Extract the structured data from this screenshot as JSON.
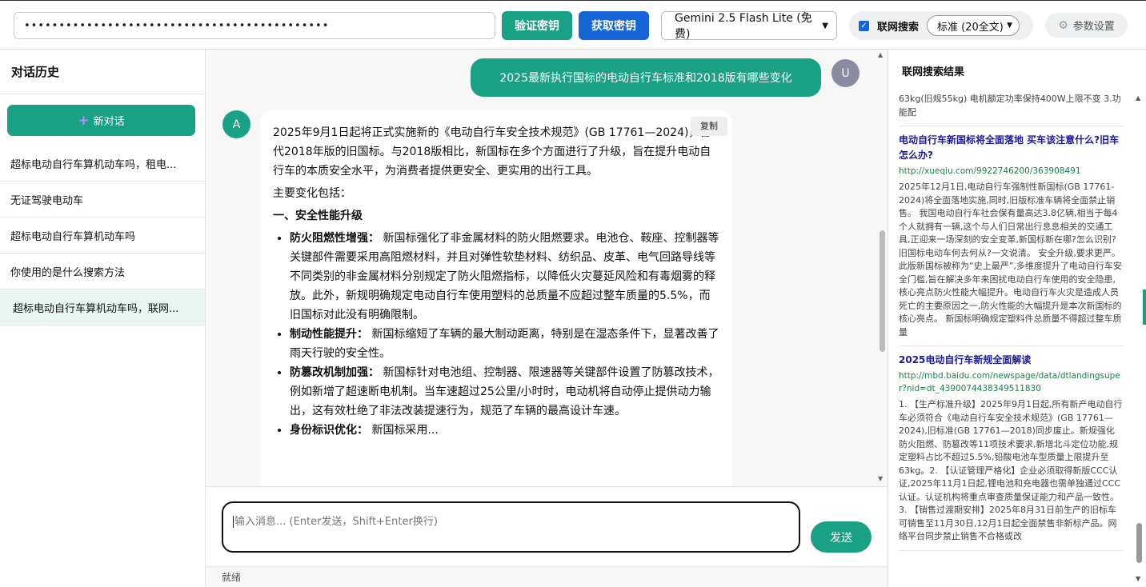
{
  "topbar": {
    "api_key_value": "••••••••••••••••••••••••••••••••••••••••••••",
    "verify_key_label": "验证密钥",
    "get_key_label": "获取密钥",
    "model_selected": "Gemini 2.5 Flash Lite (免费)",
    "web_search_label": "联网搜索",
    "web_search_checked": true,
    "search_mode_selected": "标准 (20全文)",
    "settings_label": "参数设置"
  },
  "sidebar": {
    "title": "对话历史",
    "new_chat_label": "新对话",
    "items": [
      {
        "label": "超标电动自行车算机动车吗，租电..."
      },
      {
        "label": "无证驾驶电动车"
      },
      {
        "label": "超标电动自行车算机动车吗"
      },
      {
        "label": "你使用的是什么搜索方法"
      },
      {
        "label": "超标电动自行车算机动车吗，联网..."
      }
    ],
    "active_index": 4
  },
  "chat": {
    "user_avatar": "U",
    "user_message": "2025最新执行国标的电动自行车标准和2018版有哪些变化",
    "ai_avatar": "A",
    "copy_label": "复制",
    "ai_intro": "2025年9月1日起将正式实施新的《电动自行车安全技术规范》(GB 17761—2024)，替代2018年版的旧国标。与2018版相比，新国标在多个方面进行了升级，旨在提升电动自行车的本质安全水平，为消费者提供更安全、更实用的出行工具。",
    "ai_changes_intro": "主要变化包括：",
    "section1_title": "一、安全性能升级",
    "bullets": [
      {
        "bold": "防火阻燃性增强：",
        "text": " 新国标强化了非金属材料的防火阻燃要求。电池仓、鞍座、控制器等关键部件需要采用高阻燃材料，并且对弹性软垫材料、纺织品、皮革、电气回路导线等不同类别的非金属材料分别规定了防火阻燃指标，以降低火灾蔓延风险和有毒烟雾的释放。此外，新规明确规定电动自行车使用塑料的总质量不应超过整车质量的5.5%，而旧国标对此没有明确限制。"
      },
      {
        "bold": "制动性能提升：",
        "text": " 新国标缩短了车辆的最大制动距离，特别是在湿态条件下，显著改善了雨天行驶的安全性。"
      },
      {
        "bold": "防篡改机制加强：",
        "text": " 新国标针对电池组、控制器、限速器等关键部件设置了防篡改技术，例如新增了超速断电机制。当车速超过25公里/小时时，电动机将自动停止提供动力输出，这有效杜绝了非法改装提速行为，规范了车辆的最高设计车速。"
      },
      {
        "bold": "身份标识优化：",
        "text": " 新国标采用..."
      }
    ]
  },
  "composer": {
    "placeholder": "输入消息... (Enter发送，Shift+Enter换行)",
    "send_label": "发送",
    "status": "就绪"
  },
  "search_panel": {
    "title": "联网搜索结果",
    "top_snippet": "63kg(旧规55kg) 电机额定功率保持400W上限不变 3.功能配",
    "results": [
      {
        "title": "电动自行车新国标将全面落地 买车该注意什么?旧车怎么办?",
        "url": "http://xueqiu.com/9922746200/363908491",
        "snippet": "2025年12月1日,电动自行车强制性新国标(GB 17761-2024)将全面落地实施,同时,旧版标准车辆将全面禁止销售。 我国电动自行车社会保有量高达3.8亿辆,相当于每4个人就拥有一辆,这个与人们日常出行息息相关的交通工具,正迎来一场深刻的安全变革,新国标新在哪?怎么识别?旧国标电动车何去何从?一文说清。 安全升级,要求更严。此版新国标被称为“史上最严”,多维度提升了电动自行车安全门槛,旨在解决多年来困扰电动自行车使用的安全隐患,核心亮点防火性能大幅提升。电动自行车火灾是造成人员死亡的主要原因之一,防火性能的大幅提升是本次新国标的核心亮点。 新国标明确规定塑料件总质量不得超过整车质量"
      },
      {
        "title": "2025电动自行车新规全面解读",
        "url": "http://mbd.baidu.com/newspage/data/dtlandingsuper?nid=dt_4390074438349511830",
        "snippet": "1. 【生产标准升级】2025年9月1日起,所有新产电动自行车必须符合《电动自行车安全技术规范》(GB 17761—2024),旧标准(GB 17761—2018)同步废止。新规强化防火阻燃、防篡改等11项技术要求,新增北斗定位功能,规定塑料占比不超过5.5%,铅酸电池车型质量上限提升至63kg。2. 【认证管理严格化】企业必须取得新版CCC认证,2025年11月1日起,锂电池和充电器也需单独通过CCC认证。认证机构将重点审查质量保证能力和产品一致性。3. 【销售过渡期安排】2025年8月31日前生产的旧标车可销售至11月30日,12月1日起全面禁售非新标产品。网络平台同步禁止销售不合格或改"
      }
    ]
  },
  "colors": {
    "accent_green": "#1aa085",
    "accent_blue": "#1565d8",
    "link_title": "#1a1aa0",
    "url_green": "#1a7f4b"
  },
  "icons": [
    "plus-icon",
    "gear-icon",
    "checkbox-icon",
    "chevron-down-icon"
  ]
}
